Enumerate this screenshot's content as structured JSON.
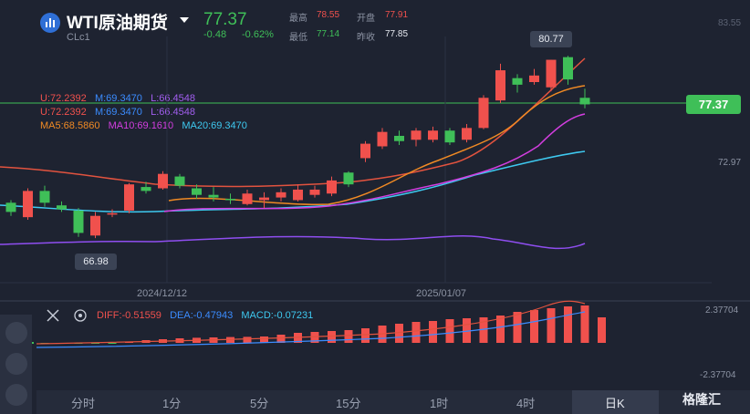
{
  "header": {
    "title": "WTI原油期货",
    "code": "CLc1",
    "price": "77.37",
    "change": "-0.48",
    "change_pct": "-0.62%",
    "high_label": "最高",
    "high": "78.55",
    "open_label": "开盘",
    "open": "77.91",
    "low_label": "最低",
    "low": "77.14",
    "prev_close_label": "昨收",
    "prev_close": "77.85"
  },
  "indicators": {
    "boll_1": {
      "u": "U:72.2392",
      "m": "M:69.3470",
      "l": "L:66.4548"
    },
    "boll_2": {
      "u": "U:72.2392",
      "m": "M:69.3470",
      "l": "L:66.4548"
    },
    "ma": {
      "ma5": "MA5:68.5860",
      "ma10": "MA10:69.1610",
      "ma20": "MA20:69.3470"
    },
    "macd": {
      "diff": "DIFF:-0.51559",
      "dea": "DEA:-0.47943",
      "macd": "MACD:-0.07231"
    }
  },
  "axis": {
    "y_top": "83.55",
    "y_mid": "72.97",
    "x_labels": [
      "2024/12/12",
      "2025/01/07"
    ],
    "macd_top": "2.37704",
    "macd_bottom": "-2.37704"
  },
  "price_tag": "77.37",
  "high_marker": "80.77",
  "low_marker": "66.98",
  "tabs": [
    "分时",
    "1分",
    "5分",
    "15分",
    "1时",
    "4时",
    "日K"
  ],
  "watermark": "格隆汇",
  "colors": {
    "up": "#f0514d",
    "down": "#3fbf58",
    "bg": "#1e2331"
  },
  "chart_data": {
    "type": "candlestick",
    "candles": [
      {
        "o": 69.9,
        "c": 69.2,
        "h": 70.1,
        "l": 68.9
      },
      {
        "o": 68.8,
        "c": 70.8,
        "h": 71.0,
        "l": 68.6
      },
      {
        "o": 70.8,
        "c": 69.9,
        "h": 71.2,
        "l": 69.6
      },
      {
        "o": 69.7,
        "c": 69.4,
        "h": 70.0,
        "l": 69.2
      },
      {
        "o": 69.3,
        "c": 67.6,
        "h": 69.5,
        "l": 67.3
      },
      {
        "o": 67.4,
        "c": 68.9,
        "h": 69.2,
        "l": 67.2
      },
      {
        "o": 69.0,
        "c": 69.1,
        "h": 69.4,
        "l": 68.8
      },
      {
        "o": 69.3,
        "c": 71.3,
        "h": 71.4,
        "l": 69.1
      },
      {
        "o": 71.1,
        "c": 70.8,
        "h": 71.5,
        "l": 70.6
      },
      {
        "o": 71.0,
        "c": 72.1,
        "h": 72.3,
        "l": 70.9
      },
      {
        "o": 71.9,
        "c": 71.2,
        "h": 72.1,
        "l": 71.0
      },
      {
        "o": 71.0,
        "c": 70.5,
        "h": 71.3,
        "l": 70.2
      },
      {
        "o": 70.5,
        "c": 70.3,
        "h": 71.1,
        "l": 70.0
      },
      {
        "o": 70.2,
        "c": 70.1,
        "h": 70.6,
        "l": 69.8
      },
      {
        "o": 69.8,
        "c": 70.6,
        "h": 70.9,
        "l": 69.7
      },
      {
        "o": 70.1,
        "c": 70.3,
        "h": 70.7,
        "l": 69.5
      },
      {
        "o": 70.3,
        "c": 70.7,
        "h": 71.0,
        "l": 70.0
      },
      {
        "o": 70.1,
        "c": 70.9,
        "h": 71.3,
        "l": 70.0
      },
      {
        "o": 70.5,
        "c": 70.9,
        "h": 71.2,
        "l": 70.3
      },
      {
        "o": 70.6,
        "c": 71.6,
        "h": 71.9,
        "l": 70.4
      },
      {
        "o": 72.2,
        "c": 71.3,
        "h": 72.3,
        "l": 71.1
      },
      {
        "o": 73.3,
        "c": 74.4,
        "h": 74.6,
        "l": 73.0
      },
      {
        "o": 74.2,
        "c": 75.3,
        "h": 75.6,
        "l": 74.0
      },
      {
        "o": 75.0,
        "c": 74.6,
        "h": 75.4,
        "l": 74.3
      },
      {
        "o": 74.7,
        "c": 75.4,
        "h": 75.6,
        "l": 74.2
      },
      {
        "o": 74.7,
        "c": 75.4,
        "h": 75.7,
        "l": 74.5
      },
      {
        "o": 75.4,
        "c": 74.5,
        "h": 75.6,
        "l": 74.3
      },
      {
        "o": 74.7,
        "c": 75.6,
        "h": 75.9,
        "l": 74.5
      },
      {
        "o": 75.6,
        "c": 77.9,
        "h": 78.1,
        "l": 75.5
      },
      {
        "o": 77.7,
        "c": 80.0,
        "h": 80.5,
        "l": 77.5
      },
      {
        "o": 79.4,
        "c": 78.9,
        "h": 79.7,
        "l": 78.3
      },
      {
        "o": 79.1,
        "c": 79.6,
        "h": 80.1,
        "l": 78.9
      },
      {
        "o": 78.7,
        "c": 80.8,
        "h": 80.8,
        "l": 78.4
      },
      {
        "o": 81.0,
        "c": 79.3,
        "h": 81.1,
        "l": 78.9
      },
      {
        "o": 77.9,
        "c": 77.4,
        "h": 78.6,
        "l": 77.1
      }
    ],
    "macd_hist": [
      -0.05,
      -0.05,
      -0.05,
      -0.05,
      -0.05,
      -0.05,
      0.05,
      0.15,
      0.2,
      0.25,
      0.28,
      0.3,
      0.32,
      0.33,
      0.35,
      0.45,
      0.55,
      0.6,
      0.65,
      0.7,
      0.8,
      0.95,
      1.05,
      1.15,
      1.2,
      1.3,
      1.35,
      1.4,
      1.5,
      1.7,
      1.8,
      1.9,
      2.0,
      2.05,
      1.4
    ]
  }
}
